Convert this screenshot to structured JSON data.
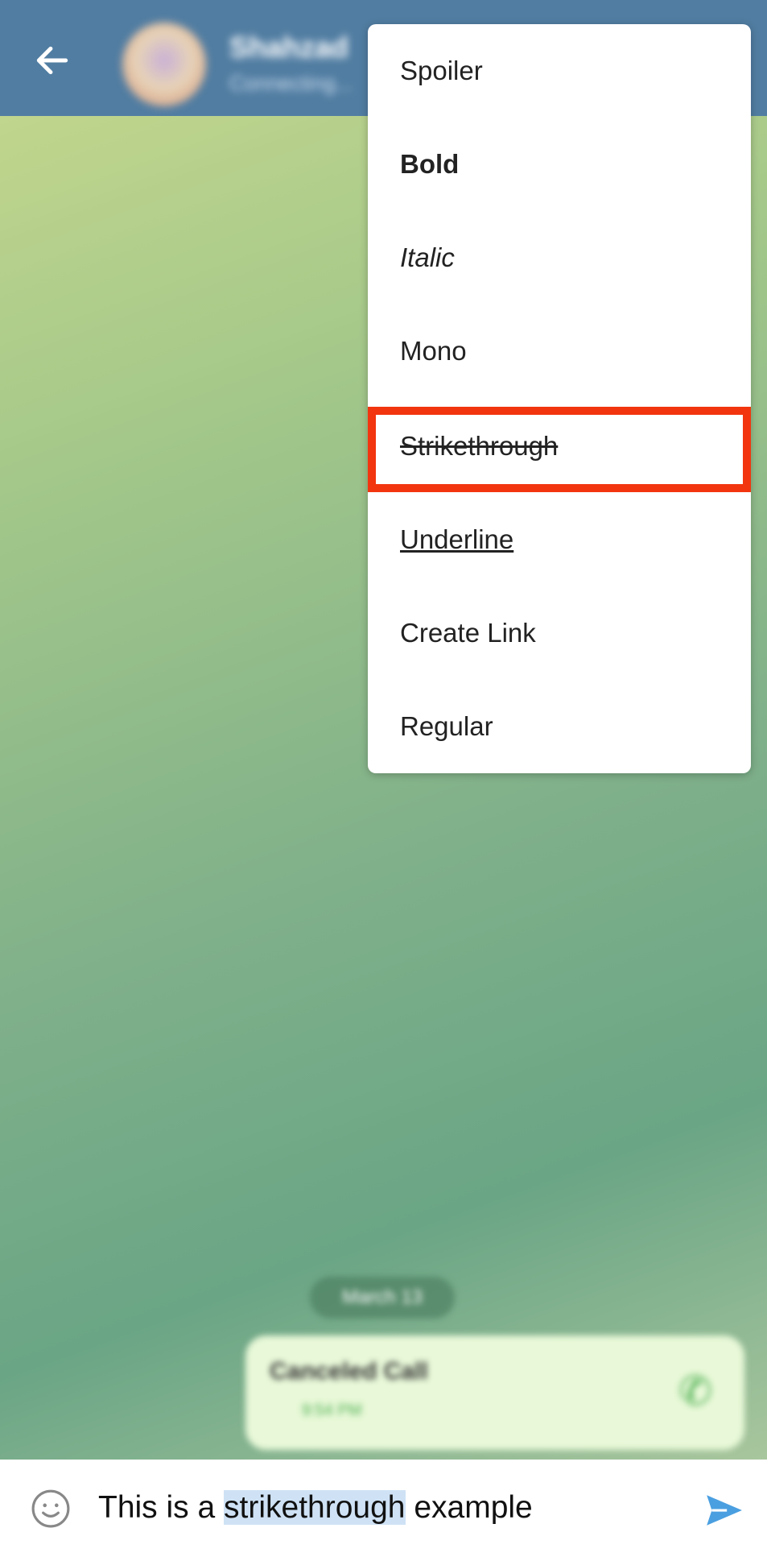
{
  "header": {
    "back_icon": "arrow-left-icon",
    "name": "Shahzad",
    "status": "Connecting..."
  },
  "menu": {
    "items": [
      {
        "label": "Spoiler",
        "style": "spoiler"
      },
      {
        "label": "Bold",
        "style": "bold"
      },
      {
        "label": "Italic",
        "style": "italic"
      },
      {
        "label": "Mono",
        "style": "mono"
      },
      {
        "label": "Strikethrough",
        "style": "strikethrough",
        "highlighted": true
      },
      {
        "label": "Underline",
        "style": "underline"
      },
      {
        "label": "Create Link",
        "style": "link"
      },
      {
        "label": "Regular",
        "style": "regular"
      }
    ],
    "highlight_color": "#f2350f"
  },
  "chat": {
    "date": "March 13",
    "message": {
      "title": "Canceled Call",
      "time": "9:54 PM",
      "icon": "phone-icon"
    }
  },
  "input": {
    "before": "This is a ",
    "selected": "strikethrough",
    "after": " example",
    "emoji_icon": "smiley-icon",
    "send_icon": "send-icon",
    "selection_color": "#cfe2f5"
  }
}
